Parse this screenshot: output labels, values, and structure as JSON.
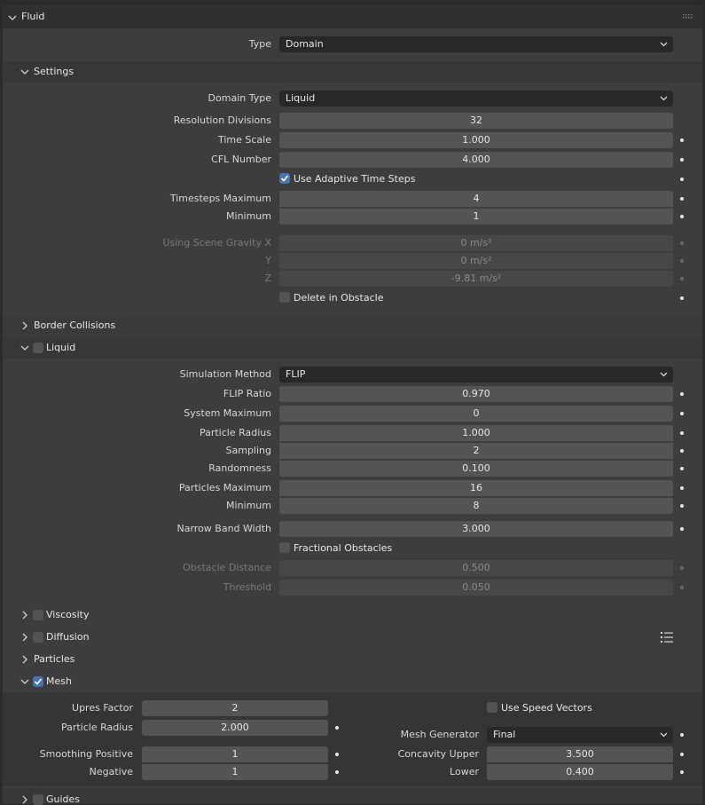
{
  "panel": {
    "title": "Fluid",
    "type_label": "Type",
    "type_value": "Domain"
  },
  "settings": {
    "title": "Settings",
    "domain_type_label": "Domain Type",
    "domain_type_value": "Liquid",
    "resolution_label": "Resolution Divisions",
    "resolution_value": "32",
    "time_scale_label": "Time Scale",
    "time_scale_value": "1.000",
    "cfl_label": "CFL Number",
    "cfl_value": "4.000",
    "adaptive_label": "Use Adaptive Time Steps",
    "timesteps_max_label": "Timesteps Maximum",
    "timesteps_max_value": "4",
    "timesteps_min_label": "Minimum",
    "timesteps_min_value": "1",
    "gravity_x_label": "Using Scene Gravity X",
    "gravity_x_value": "0 m/s²",
    "gravity_y_label": "Y",
    "gravity_y_value": "0 m/s²",
    "gravity_z_label": "Z",
    "gravity_z_value": "-9.81 m/s²",
    "delete_obstacle_label": "Delete in Obstacle"
  },
  "border": {
    "title": "Border Collisions"
  },
  "liquid": {
    "title": "Liquid",
    "sim_method_label": "Simulation Method",
    "sim_method_value": "FLIP",
    "flip_ratio_label": "FLIP Ratio",
    "flip_ratio_value": "0.970",
    "system_max_label": "System Maximum",
    "system_max_value": "0",
    "particle_radius_label": "Particle Radius",
    "particle_radius_value": "1.000",
    "sampling_label": "Sampling",
    "sampling_value": "2",
    "randomness_label": "Randomness",
    "randomness_value": "0.100",
    "particles_max_label": "Particles Maximum",
    "particles_max_value": "16",
    "particles_min_label": "Minimum",
    "particles_min_value": "8",
    "narrow_band_label": "Narrow Band Width",
    "narrow_band_value": "3.000",
    "fractional_label": "Fractional Obstacles",
    "obstacle_dist_label": "Obstacle Distance",
    "obstacle_dist_value": "0.500",
    "threshold_label": "Threshold",
    "threshold_value": "0.050"
  },
  "viscosity": {
    "title": "Viscosity"
  },
  "diffusion": {
    "title": "Diffusion"
  },
  "particles": {
    "title": "Particles"
  },
  "mesh": {
    "title": "Mesh",
    "upres_label": "Upres Factor",
    "upres_value": "2",
    "particle_radius_label": "Particle Radius",
    "particle_radius_value": "2.000",
    "smooth_pos_label": "Smoothing Positive",
    "smooth_pos_value": "1",
    "smooth_neg_label": "Negative",
    "smooth_neg_value": "1",
    "speed_vectors_label": "Use Speed Vectors",
    "generator_label": "Mesh Generator",
    "generator_value": "Final",
    "concavity_upper_label": "Concavity Upper",
    "concavity_upper_value": "3.500",
    "concavity_lower_label": "Lower",
    "concavity_lower_value": "0.400"
  },
  "guides": {
    "title": "Guides"
  },
  "icons": {
    "expanded": "chevron-down-icon",
    "collapsed": "chevron-right-icon",
    "menu": "list-menu-icon",
    "grip": "drag-grip-icon"
  },
  "colors": {
    "accent": "#4772b3",
    "field": "#545454",
    "panel": "#3d3d3d",
    "header": "#303030"
  }
}
